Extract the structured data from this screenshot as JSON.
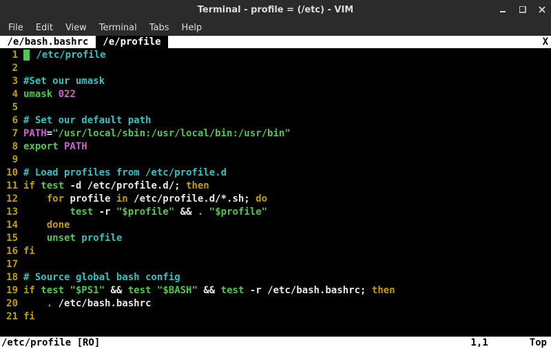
{
  "window": {
    "title": "Terminal - profile = (/etc) - VIM"
  },
  "menu": {
    "file": "File",
    "edit": "Edit",
    "view": "View",
    "terminal": "Terminal",
    "tabs": "Tabs",
    "help": "Help"
  },
  "tabs": {
    "inactive": " /e/bash.bashrc ",
    "active": " /e/profile ",
    "close": "X"
  },
  "lines": {
    "l1": {
      "n": "1"
    },
    "l1_path": " /etc/profile",
    "l2": {
      "n": "2"
    },
    "l3": {
      "n": "3"
    },
    "l3_comment": "#Set our umask",
    "l4": {
      "n": "4"
    },
    "l4_kw": "umask",
    "l4_val": " 022",
    "l5": {
      "n": "5"
    },
    "l6": {
      "n": "6"
    },
    "l6_comment": "# Set our default path",
    "l7": {
      "n": "7"
    },
    "l7_var": "PATH",
    "l7_eq": "=",
    "l7_str": "\"/usr/local/sbin:/usr/local/bin:/usr/bin\"",
    "l8": {
      "n": "8"
    },
    "l8_kw": "export",
    "l8_var": " PATH",
    "l9": {
      "n": "9"
    },
    "l10": {
      "n": "10"
    },
    "l10_comment": "# Load profiles from /etc/profile.d",
    "l11": {
      "n": "11"
    },
    "l11_if": "if",
    "l11_test": " test",
    "l11_rest": " -d /etc/profile.d/;",
    "l11_then": " then",
    "l12": {
      "n": "12"
    },
    "l12_indent": "    ",
    "l12_for": "for",
    "l12_mid": " profile ",
    "l12_in": "in",
    "l12_rest": " /etc/profile.d/*.sh;",
    "l12_do": " do",
    "l13": {
      "n": "13"
    },
    "l13_indent": "        ",
    "l13_test": "test",
    "l13_flag": " -r ",
    "l13_str1": "\"$profile\"",
    "l13_and": " && ",
    "l13_dot": ".",
    "l13_sp": " ",
    "l13_str2": "\"$profile\"",
    "l14": {
      "n": "14"
    },
    "l14_indent": "    ",
    "l14_done": "done",
    "l15": {
      "n": "15"
    },
    "l15_indent": "    ",
    "l15_unset": "unset",
    "l15_var": " profile",
    "l16": {
      "n": "16"
    },
    "l16_fi": "fi",
    "l17": {
      "n": "17"
    },
    "l18": {
      "n": "18"
    },
    "l18_comment": "# Source global bash config",
    "l19": {
      "n": "19"
    },
    "l19_if": "if",
    "l19_test1": " test",
    "l19_sp1": " ",
    "l19_ps1": "\"$PS1\"",
    "l19_and1": " && ",
    "l19_test2": "test",
    "l19_sp2": " ",
    "l19_bash": "\"$BASH\"",
    "l19_and2": " && ",
    "l19_test3": "test",
    "l19_rest": " -r /etc/bash.bashrc;",
    "l19_then": " then",
    "l20": {
      "n": "20"
    },
    "l20_indent": "    ",
    "l20_dot": ".",
    "l20_rest": " /etc/bash.bashrc",
    "l21": {
      "n": "21"
    },
    "l21_fi": "fi"
  },
  "status": {
    "left": "/etc/profile [RO]",
    "pos": "1,1",
    "right": "Top"
  }
}
